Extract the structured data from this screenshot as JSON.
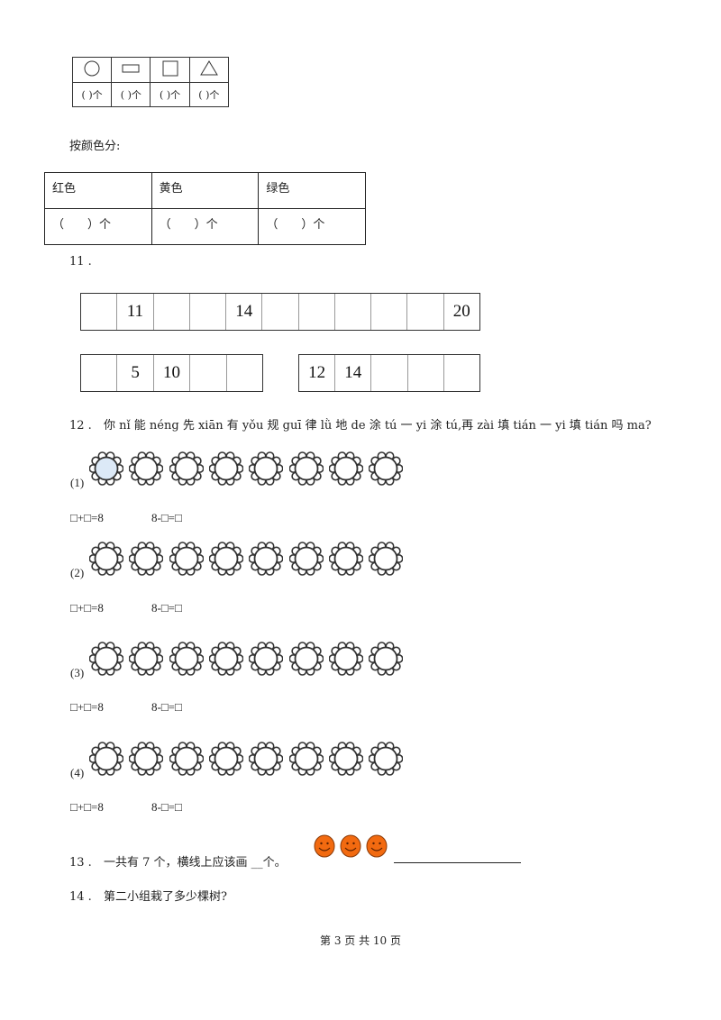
{
  "shape_table": {
    "shapes": [
      {
        "icon": "circle-icon"
      },
      {
        "icon": "rectangle-icon"
      },
      {
        "icon": "square-icon"
      },
      {
        "icon": "triangle-icon"
      }
    ],
    "answers": [
      "( )个",
      "( )个",
      "( )个",
      "( )个"
    ]
  },
  "color_section": {
    "label": "按颜色分:",
    "headers": [
      "红色",
      "黄色",
      "绿色"
    ],
    "answers": [
      "（　　）个",
      "（　　）个",
      "（　　）个"
    ]
  },
  "q11": {
    "number": "11 .",
    "row1": [
      "",
      "11",
      "",
      "",
      "14",
      "",
      "",
      "",
      "",
      "",
      "20"
    ],
    "row2_left": [
      "",
      "5",
      "10",
      "",
      ""
    ],
    "row2_right": [
      "12",
      "14",
      "",
      "",
      ""
    ]
  },
  "q12": {
    "number": "12 .",
    "text": "你 nǐ 能 néng 先 xiān 有 yǒu 规 guī 律 lǜ 地 de 涂 tú 一 yi 涂 tú,再 zài 填 tián 一 yi 填 tián 吗 ma?",
    "groups": [
      {
        "label": "(1)",
        "flowers": 8,
        "colored": [
          0
        ],
        "eq1": "□+□=8",
        "eq2": "8-□=□"
      },
      {
        "label": "(2)",
        "flowers": 8,
        "colored": [],
        "eq1": "□+□=8",
        "eq2": "8-□=□"
      },
      {
        "label": "(3)",
        "flowers": 8,
        "colored": [],
        "eq1": "□+□=8",
        "eq2": "8-□=□"
      },
      {
        "label": "(4)",
        "flowers": 8,
        "colored": [],
        "eq1": "□+□=8",
        "eq2": "8-□=□"
      }
    ],
    "fill_color": "#dce9f7"
  },
  "q13": {
    "number": "13 .",
    "text": "一共有 7 个，横线上应该画 __个。",
    "smiley_count": 3,
    "smiley_color": "#f26a10"
  },
  "q14": {
    "number": "14 .",
    "text": "第二小组栽了多少棵树?"
  },
  "footer": {
    "text": "第 3 页 共 10 页"
  }
}
